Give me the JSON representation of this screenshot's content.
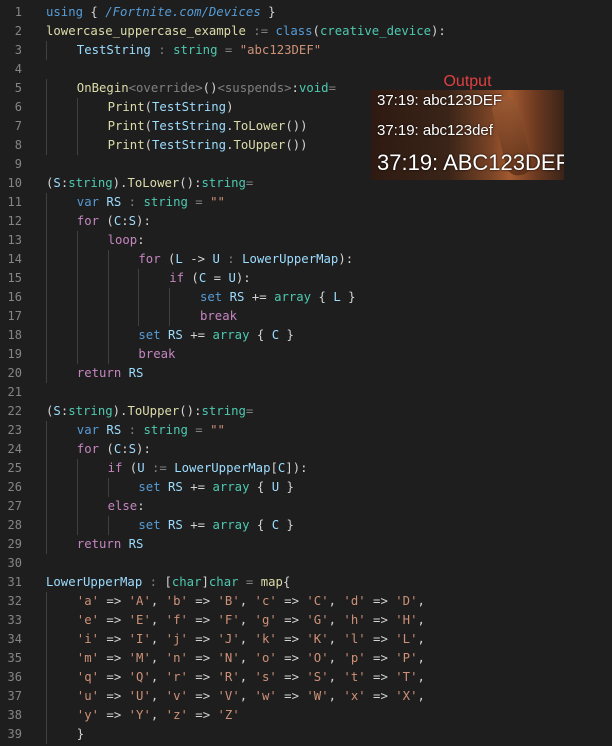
{
  "code": {
    "line_numbers": [
      "1",
      "2",
      "3",
      "4",
      "5",
      "6",
      "7",
      "8",
      "9",
      "10",
      "11",
      "12",
      "13",
      "14",
      "15",
      "16",
      "17",
      "18",
      "19",
      "20",
      "21",
      "22",
      "23",
      "24",
      "25",
      "26",
      "27",
      "28",
      "29",
      "30",
      "31",
      "32",
      "33",
      "34",
      "35",
      "36",
      "37",
      "38",
      "39"
    ],
    "lines": [
      {
        "indent": 0,
        "tokens": [
          [
            "k",
            "using"
          ],
          [
            "p",
            " { "
          ],
          [
            "u",
            "/Fortnite.com/Devices"
          ],
          [
            "p",
            " }"
          ]
        ]
      },
      {
        "indent": 0,
        "tokens": [
          [
            "f",
            "lowercase_uppercase_example"
          ],
          [
            "o",
            " := "
          ],
          [
            "k",
            "class"
          ],
          [
            "p",
            "("
          ],
          [
            "t",
            "creative_device"
          ],
          [
            "p",
            "):"
          ]
        ]
      },
      {
        "indent": 1,
        "tokens": [
          [
            "v",
            "TestString"
          ],
          [
            "o",
            " : "
          ],
          [
            "t",
            "string"
          ],
          [
            "o",
            " = "
          ],
          [
            "s",
            "\"abc123DEF\""
          ]
        ]
      },
      {
        "indent": 0,
        "tokens": []
      },
      {
        "indent": 1,
        "tokens": [
          [
            "f",
            "OnBegin"
          ],
          [
            "o",
            "<override>"
          ],
          [
            "p",
            "()"
          ],
          [
            "o",
            "<suspends>"
          ],
          [
            "p",
            ":"
          ],
          [
            "t",
            "void"
          ],
          [
            "o",
            "="
          ]
        ]
      },
      {
        "indent": 2,
        "tokens": [
          [
            "f",
            "Print"
          ],
          [
            "p",
            "("
          ],
          [
            "v",
            "TestString"
          ],
          [
            "p",
            ")"
          ]
        ]
      },
      {
        "indent": 2,
        "tokens": [
          [
            "f",
            "Print"
          ],
          [
            "p",
            "("
          ],
          [
            "v",
            "TestString"
          ],
          [
            "p",
            "."
          ],
          [
            "f",
            "ToLower"
          ],
          [
            "p",
            "())"
          ]
        ]
      },
      {
        "indent": 2,
        "tokens": [
          [
            "f",
            "Print"
          ],
          [
            "p",
            "("
          ],
          [
            "v",
            "TestString"
          ],
          [
            "p",
            "."
          ],
          [
            "f",
            "ToUpper"
          ],
          [
            "p",
            "())"
          ]
        ]
      },
      {
        "indent": 0,
        "tokens": []
      },
      {
        "indent": 0,
        "tokens": [
          [
            "p",
            "("
          ],
          [
            "v",
            "S"
          ],
          [
            "p",
            ":"
          ],
          [
            "t",
            "string"
          ],
          [
            "p",
            ")."
          ],
          [
            "f",
            "ToLower"
          ],
          [
            "p",
            "():"
          ],
          [
            "t",
            "string"
          ],
          [
            "o",
            "="
          ]
        ]
      },
      {
        "indent": 1,
        "tokens": [
          [
            "k",
            "var"
          ],
          [
            "p",
            " "
          ],
          [
            "v",
            "RS"
          ],
          [
            "o",
            " : "
          ],
          [
            "t",
            "string"
          ],
          [
            "o",
            " = "
          ],
          [
            "s",
            "\"\""
          ]
        ]
      },
      {
        "indent": 1,
        "tokens": [
          [
            "c",
            "for"
          ],
          [
            "p",
            " ("
          ],
          [
            "v",
            "C"
          ],
          [
            "p",
            ":"
          ],
          [
            "v",
            "S"
          ],
          [
            "p",
            "):"
          ]
        ]
      },
      {
        "indent": 2,
        "tokens": [
          [
            "c",
            "loop"
          ],
          [
            "p",
            ":"
          ]
        ]
      },
      {
        "indent": 3,
        "tokens": [
          [
            "c",
            "for"
          ],
          [
            "p",
            " ("
          ],
          [
            "v",
            "L"
          ],
          [
            "p",
            " -> "
          ],
          [
            "v",
            "U"
          ],
          [
            "o",
            " : "
          ],
          [
            "v",
            "LowerUpperMap"
          ],
          [
            "p",
            "):"
          ]
        ]
      },
      {
        "indent": 4,
        "tokens": [
          [
            "c",
            "if"
          ],
          [
            "p",
            " ("
          ],
          [
            "v",
            "C"
          ],
          [
            "p",
            " = "
          ],
          [
            "v",
            "U"
          ],
          [
            "p",
            "):"
          ]
        ]
      },
      {
        "indent": 5,
        "tokens": [
          [
            "k",
            "set"
          ],
          [
            "p",
            " "
          ],
          [
            "v",
            "RS"
          ],
          [
            "p",
            " += "
          ],
          [
            "t",
            "array"
          ],
          [
            "p",
            " { "
          ],
          [
            "v",
            "L"
          ],
          [
            "p",
            " }"
          ]
        ]
      },
      {
        "indent": 5,
        "tokens": [
          [
            "c",
            "break"
          ]
        ]
      },
      {
        "indent": 3,
        "tokens": [
          [
            "k",
            "set"
          ],
          [
            "p",
            " "
          ],
          [
            "v",
            "RS"
          ],
          [
            "p",
            " += "
          ],
          [
            "t",
            "array"
          ],
          [
            "p",
            " { "
          ],
          [
            "v",
            "C"
          ],
          [
            "p",
            " }"
          ]
        ]
      },
      {
        "indent": 3,
        "tokens": [
          [
            "c",
            "break"
          ]
        ]
      },
      {
        "indent": 1,
        "tokens": [
          [
            "c",
            "return"
          ],
          [
            "p",
            " "
          ],
          [
            "v",
            "RS"
          ]
        ]
      },
      {
        "indent": 0,
        "tokens": []
      },
      {
        "indent": 0,
        "tokens": [
          [
            "p",
            "("
          ],
          [
            "v",
            "S"
          ],
          [
            "p",
            ":"
          ],
          [
            "t",
            "string"
          ],
          [
            "p",
            ")."
          ],
          [
            "f",
            "ToUpper"
          ],
          [
            "p",
            "():"
          ],
          [
            "t",
            "string"
          ],
          [
            "o",
            "="
          ]
        ]
      },
      {
        "indent": 1,
        "tokens": [
          [
            "k",
            "var"
          ],
          [
            "p",
            " "
          ],
          [
            "v",
            "RS"
          ],
          [
            "o",
            " : "
          ],
          [
            "t",
            "string"
          ],
          [
            "o",
            " = "
          ],
          [
            "s",
            "\"\""
          ]
        ]
      },
      {
        "indent": 1,
        "tokens": [
          [
            "c",
            "for"
          ],
          [
            "p",
            " ("
          ],
          [
            "v",
            "C"
          ],
          [
            "p",
            ":"
          ],
          [
            "v",
            "S"
          ],
          [
            "p",
            "):"
          ]
        ]
      },
      {
        "indent": 2,
        "tokens": [
          [
            "c",
            "if"
          ],
          [
            "p",
            " ("
          ],
          [
            "v",
            "U"
          ],
          [
            "o",
            " := "
          ],
          [
            "v",
            "LowerUpperMap"
          ],
          [
            "p",
            "["
          ],
          [
            "v",
            "C"
          ],
          [
            "p",
            "]):"
          ]
        ]
      },
      {
        "indent": 3,
        "tokens": [
          [
            "k",
            "set"
          ],
          [
            "p",
            " "
          ],
          [
            "v",
            "RS"
          ],
          [
            "p",
            " += "
          ],
          [
            "t",
            "array"
          ],
          [
            "p",
            " { "
          ],
          [
            "v",
            "U"
          ],
          [
            "p",
            " }"
          ]
        ]
      },
      {
        "indent": 2,
        "tokens": [
          [
            "c",
            "else"
          ],
          [
            "p",
            ":"
          ]
        ]
      },
      {
        "indent": 3,
        "tokens": [
          [
            "k",
            "set"
          ],
          [
            "p",
            " "
          ],
          [
            "v",
            "RS"
          ],
          [
            "p",
            " += "
          ],
          [
            "t",
            "array"
          ],
          [
            "p",
            " { "
          ],
          [
            "v",
            "C"
          ],
          [
            "p",
            " }"
          ]
        ]
      },
      {
        "indent": 1,
        "tokens": [
          [
            "c",
            "return"
          ],
          [
            "p",
            " "
          ],
          [
            "v",
            "RS"
          ]
        ]
      },
      {
        "indent": 0,
        "tokens": []
      },
      {
        "indent": 0,
        "tokens": [
          [
            "v",
            "LowerUpperMap"
          ],
          [
            "o",
            " : "
          ],
          [
            "p",
            "["
          ],
          [
            "t",
            "char"
          ],
          [
            "p",
            "]"
          ],
          [
            "t",
            "char"
          ],
          [
            "o",
            " = "
          ],
          [
            "f",
            "map"
          ],
          [
            "p",
            "{"
          ]
        ]
      },
      {
        "indent": 1,
        "tokens": [
          [
            "s",
            "'a'"
          ],
          [
            "p",
            " => "
          ],
          [
            "s",
            "'A'"
          ],
          [
            "p",
            ", "
          ],
          [
            "s",
            "'b'"
          ],
          [
            "p",
            " => "
          ],
          [
            "s",
            "'B'"
          ],
          [
            "p",
            ", "
          ],
          [
            "s",
            "'c'"
          ],
          [
            "p",
            " => "
          ],
          [
            "s",
            "'C'"
          ],
          [
            "p",
            ", "
          ],
          [
            "s",
            "'d'"
          ],
          [
            "p",
            " => "
          ],
          [
            "s",
            "'D'"
          ],
          [
            "p",
            ","
          ]
        ]
      },
      {
        "indent": 1,
        "tokens": [
          [
            "s",
            "'e'"
          ],
          [
            "p",
            " => "
          ],
          [
            "s",
            "'E'"
          ],
          [
            "p",
            ", "
          ],
          [
            "s",
            "'f'"
          ],
          [
            "p",
            " => "
          ],
          [
            "s",
            "'F'"
          ],
          [
            "p",
            ", "
          ],
          [
            "s",
            "'g'"
          ],
          [
            "p",
            " => "
          ],
          [
            "s",
            "'G'"
          ],
          [
            "p",
            ", "
          ],
          [
            "s",
            "'h'"
          ],
          [
            "p",
            " => "
          ],
          [
            "s",
            "'H'"
          ],
          [
            "p",
            ","
          ]
        ]
      },
      {
        "indent": 1,
        "tokens": [
          [
            "s",
            "'i'"
          ],
          [
            "p",
            " => "
          ],
          [
            "s",
            "'I'"
          ],
          [
            "p",
            ", "
          ],
          [
            "s",
            "'j'"
          ],
          [
            "p",
            " => "
          ],
          [
            "s",
            "'J'"
          ],
          [
            "p",
            ", "
          ],
          [
            "s",
            "'k'"
          ],
          [
            "p",
            " => "
          ],
          [
            "s",
            "'K'"
          ],
          [
            "p",
            ", "
          ],
          [
            "s",
            "'l'"
          ],
          [
            "p",
            " => "
          ],
          [
            "s",
            "'L'"
          ],
          [
            "p",
            ","
          ]
        ]
      },
      {
        "indent": 1,
        "tokens": [
          [
            "s",
            "'m'"
          ],
          [
            "p",
            " => "
          ],
          [
            "s",
            "'M'"
          ],
          [
            "p",
            ", "
          ],
          [
            "s",
            "'n'"
          ],
          [
            "p",
            " => "
          ],
          [
            "s",
            "'N'"
          ],
          [
            "p",
            ", "
          ],
          [
            "s",
            "'o'"
          ],
          [
            "p",
            " => "
          ],
          [
            "s",
            "'O'"
          ],
          [
            "p",
            ", "
          ],
          [
            "s",
            "'p'"
          ],
          [
            "p",
            " => "
          ],
          [
            "s",
            "'P'"
          ],
          [
            "p",
            ","
          ]
        ]
      },
      {
        "indent": 1,
        "tokens": [
          [
            "s",
            "'q'"
          ],
          [
            "p",
            " => "
          ],
          [
            "s",
            "'Q'"
          ],
          [
            "p",
            ", "
          ],
          [
            "s",
            "'r'"
          ],
          [
            "p",
            " => "
          ],
          [
            "s",
            "'R'"
          ],
          [
            "p",
            ", "
          ],
          [
            "s",
            "'s'"
          ],
          [
            "p",
            " => "
          ],
          [
            "s",
            "'S'"
          ],
          [
            "p",
            ", "
          ],
          [
            "s",
            "'t'"
          ],
          [
            "p",
            " => "
          ],
          [
            "s",
            "'T'"
          ],
          [
            "p",
            ","
          ]
        ]
      },
      {
        "indent": 1,
        "tokens": [
          [
            "s",
            "'u'"
          ],
          [
            "p",
            " => "
          ],
          [
            "s",
            "'U'"
          ],
          [
            "p",
            ", "
          ],
          [
            "s",
            "'v'"
          ],
          [
            "p",
            " => "
          ],
          [
            "s",
            "'V'"
          ],
          [
            "p",
            ", "
          ],
          [
            "s",
            "'w'"
          ],
          [
            "p",
            " => "
          ],
          [
            "s",
            "'W'"
          ],
          [
            "p",
            ", "
          ],
          [
            "s",
            "'x'"
          ],
          [
            "p",
            " => "
          ],
          [
            "s",
            "'X'"
          ],
          [
            "p",
            ","
          ]
        ]
      },
      {
        "indent": 1,
        "tokens": [
          [
            "s",
            "'y'"
          ],
          [
            "p",
            " => "
          ],
          [
            "s",
            "'Y'"
          ],
          [
            "p",
            ", "
          ],
          [
            "s",
            "'z'"
          ],
          [
            "p",
            " => "
          ],
          [
            "s",
            "'Z'"
          ]
        ]
      },
      {
        "indent": 1,
        "tokens": [
          [
            "p",
            "}"
          ]
        ]
      }
    ]
  },
  "output": {
    "title": "Output",
    "lines": [
      "37:19: abc123DEF",
      "37:19: abc123def",
      "37:19: ABC123DEF"
    ]
  },
  "colors": {
    "background": "#1e1e1e",
    "keyword": "#569cd6",
    "control": "#c586c0",
    "function": "#dcdcaa",
    "variable": "#9cdcfe",
    "type": "#4ec9b0",
    "string": "#ce9178",
    "output_title": "#e04040"
  }
}
